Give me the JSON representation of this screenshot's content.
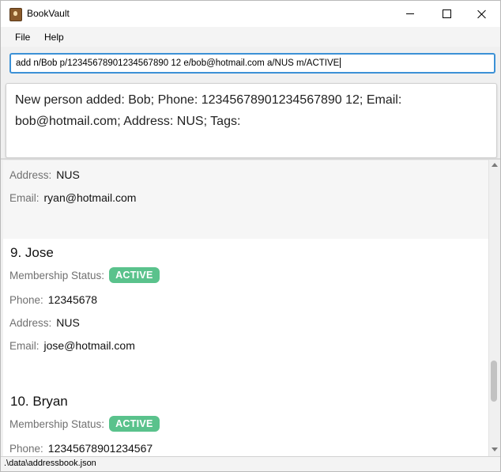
{
  "window": {
    "title": "BookVault"
  },
  "menu": {
    "file": "File",
    "help": "Help"
  },
  "command": {
    "value": "add n/Bob p/12345678901234567890 12 e/bob@hotmail.com a/NUS m/ACTIVE"
  },
  "result": {
    "line1": "New person added: Bob; Phone: 12345678901234567890 12; Email:",
    "line2": "bob@hotmail.com; Address: NUS; Tags:"
  },
  "persons": {
    "partial": {
      "address_label": "Address:",
      "address": "NUS",
      "email_label": "Email:",
      "email": "ryan@hotmail.com"
    },
    "p9": {
      "name": "9.  Jose",
      "status_label": "Membership Status:",
      "status": "ACTIVE",
      "phone_label": "Phone:",
      "phone": "12345678",
      "address_label": "Address:",
      "address": "NUS",
      "email_label": "Email:",
      "email": "jose@hotmail.com"
    },
    "p10": {
      "name": "10.  Bryan",
      "status_label": "Membership Status:",
      "status": "ACTIVE",
      "phone_label": "Phone:",
      "phone": "12345678901234567"
    }
  },
  "status_bar": {
    "path": ".\\data\\addressbook.json"
  },
  "colors": {
    "accent": "#3c91d6",
    "active_badge": "#5ac28c"
  }
}
